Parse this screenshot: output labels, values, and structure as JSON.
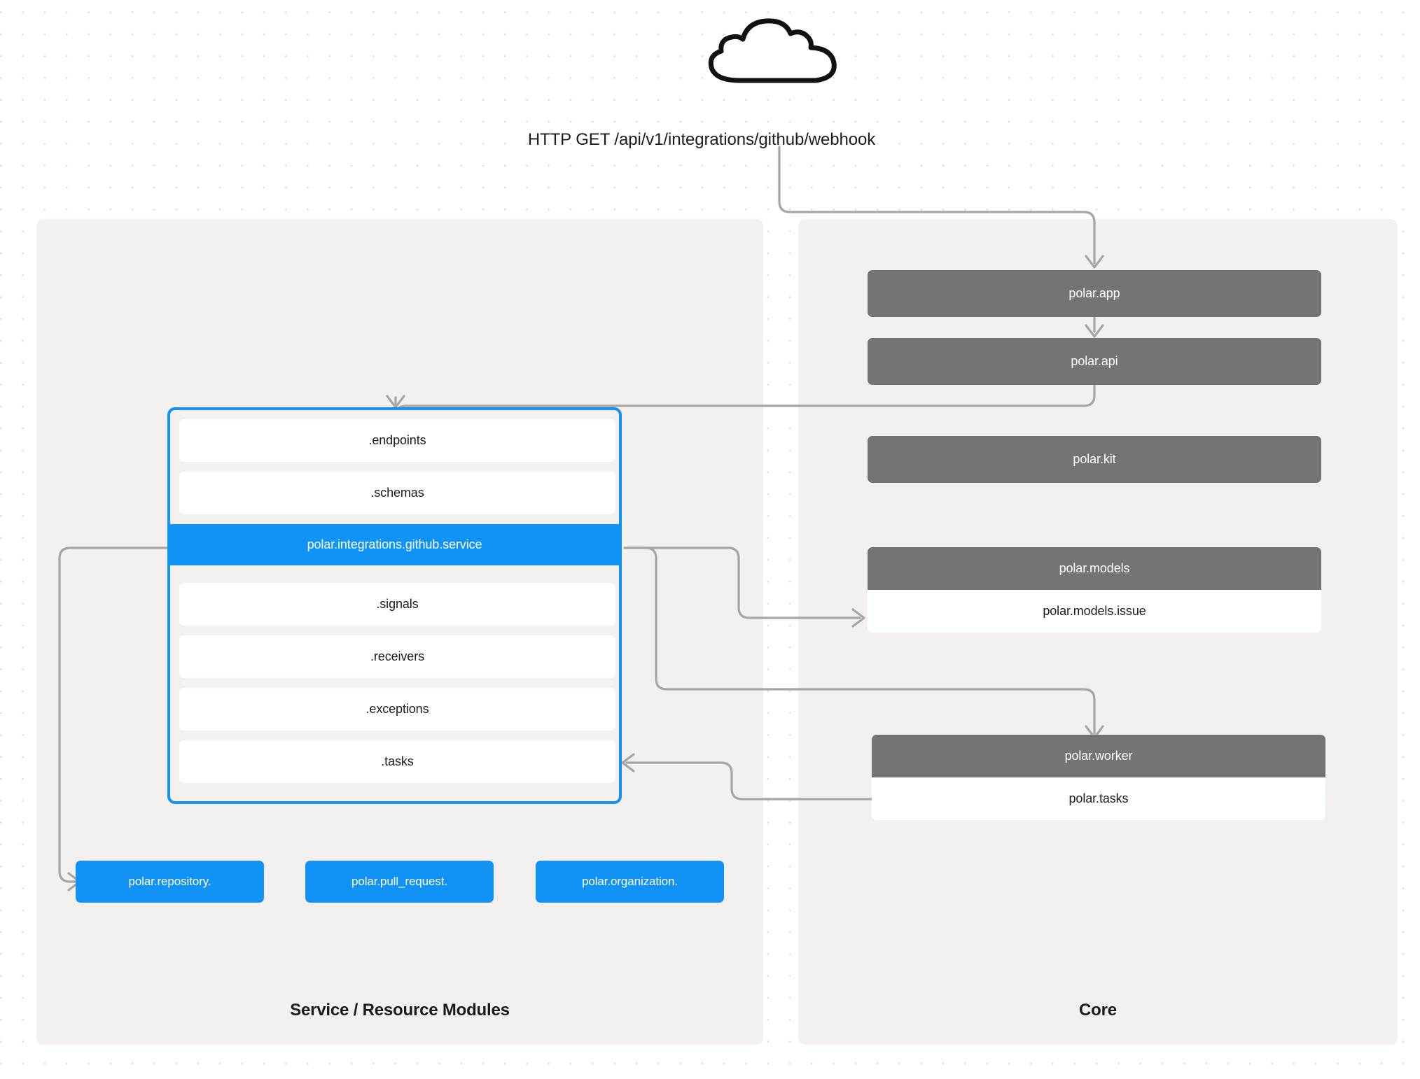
{
  "diagram": {
    "cloud_icon": "cloud-icon",
    "request_label": "HTTP GET /api/v1/integrations/github/webhook"
  },
  "panels": {
    "left": {
      "title": "Service / Resource Modules"
    },
    "right": {
      "title": "Core"
    }
  },
  "module_group": {
    "rows": [
      {
        "label": ".endpoints",
        "highlighted": false
      },
      {
        "label": ".schemas",
        "highlighted": false
      },
      {
        "label": "polar.integrations.github.service",
        "highlighted": true
      },
      {
        "label": ".signals",
        "highlighted": false
      },
      {
        "label": ".receivers",
        "highlighted": false
      },
      {
        "label": ".exceptions",
        "highlighted": false
      },
      {
        "label": ".tasks",
        "highlighted": false
      }
    ]
  },
  "resource_pills": [
    {
      "label": "polar.repository."
    },
    {
      "label": "polar.pull_request."
    },
    {
      "label": "polar.organization."
    }
  ],
  "core_nodes": {
    "app": "polar.app",
    "api": "polar.api",
    "kit": "polar.kit",
    "models": "polar.models",
    "models_issue": "polar.models.issue",
    "worker": "polar.worker",
    "tasks": "polar.tasks"
  },
  "colors": {
    "accent_blue": "#1093f5",
    "node_gray": "#767472",
    "panel_bg": "#f3f0ef",
    "edge_gray": "#a8a5a3",
    "canvas": "#ffffff"
  }
}
